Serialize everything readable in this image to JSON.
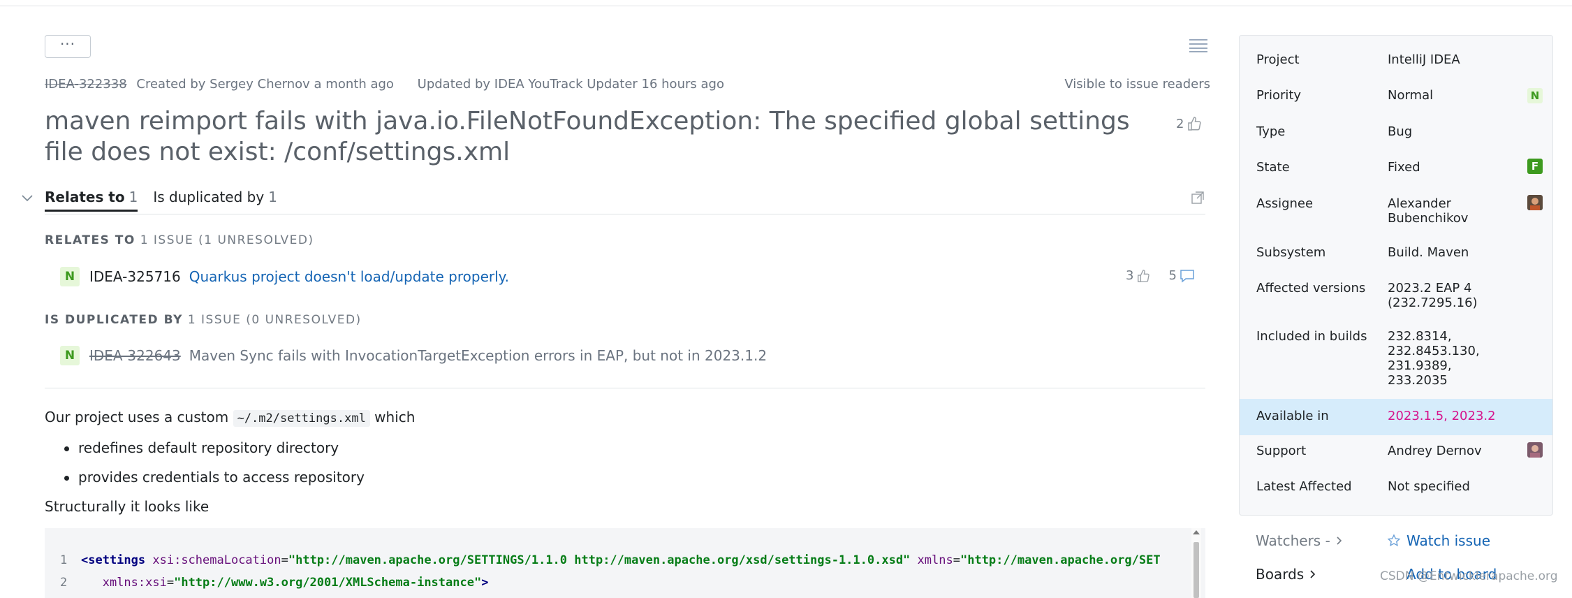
{
  "toolbar": {
    "more_label": "···"
  },
  "issue": {
    "id": "IDEA-322338",
    "created": "Created by Sergey Chernov a month ago",
    "updated": "Updated by IDEA YouTrack Updater 16 hours ago",
    "visibility": "Visible to issue readers",
    "title": "maven reimport fails with java.io.FileNotFoundException: The specified global settings file does not exist: /conf/settings.xml",
    "votes": "2"
  },
  "links": {
    "tabs": [
      {
        "label": "Relates to",
        "count": "1"
      },
      {
        "label": "Is duplicated by",
        "count": "1"
      }
    ],
    "relates": {
      "head_label": "RELATES TO",
      "head_summary": "1 ISSUE (1 UNRESOLVED)",
      "item": {
        "badge": "N",
        "id": "IDEA-325716",
        "title": "Quarkus project doesn't load/update properly.",
        "votes": "3",
        "comments": "5"
      }
    },
    "duplicated": {
      "head_label": "IS DUPLICATED BY",
      "head_summary": "1 ISSUE (0 UNRESOLVED)",
      "item": {
        "badge": "N",
        "id": "IDEA-322643",
        "title": "Maven Sync fails with InvocationTargetException errors in EAP, but not in 2023.1.2"
      }
    }
  },
  "description": {
    "intro_before": "Our project uses a custom",
    "intro_code": "~/.m2/settings.xml",
    "intro_after": "which",
    "bullets": [
      "redefines default repository directory",
      "provides credentials to access repository"
    ],
    "structurally": "Structurally it looks like",
    "code": {
      "line1_no": "1",
      "line1_tag": "<settings",
      "line1_attr1": "xsi:schemaLocation",
      "line1_eq1": "=",
      "line1_val1": "\"http://maven.apache.org/SETTINGS/1.1.0 http://maven.apache.org/xsd/settings-1.1.0.xsd\"",
      "line1_attr2": "xmlns",
      "line1_eq2": "=",
      "line1_val2": "\"http://maven.apache.org/SET",
      "line2_no": "2",
      "line2_attr": "xmlns:xsi",
      "line2_eq": "=",
      "line2_val": "\"http://www.w3.org/2001/XMLSchema-instance\"",
      "line2_end": ">"
    }
  },
  "sidebar": {
    "fields": [
      {
        "name": "Project",
        "value": "IntelliJ IDEA"
      },
      {
        "name": "Priority",
        "value": "Normal",
        "indicator": "N"
      },
      {
        "name": "Type",
        "value": "Bug"
      },
      {
        "name": "State",
        "value": "Fixed",
        "indicator": "F"
      },
      {
        "name": "Assignee",
        "value": "Alexander Bubenchikov"
      },
      {
        "name": "Subsystem",
        "value": "Build. Maven"
      },
      {
        "name": "Affected versions",
        "value": "2023.2 EAP 4 (232.7295.16)"
      },
      {
        "name": "Included in builds",
        "value": "232.8314, 232.8453.130, 231.9389, 233.2035"
      },
      {
        "name": "Available in",
        "value": "2023.1.5, 2023.2"
      },
      {
        "name": "Support",
        "value": "Andrey Dernov"
      },
      {
        "name": "Latest Affected",
        "value": "Not specified"
      }
    ],
    "watchers_label": "Watchers -",
    "watch_label": "Watch issue",
    "boards_label": "Boards",
    "add_board_label": "Add to board"
  },
  "watermark": "CSDN @Entwicklerapache.org",
  "colors": {
    "link": "#1464b4",
    "available_in": "#d6148c",
    "state_fixed": "#3d9a1f",
    "highlight_row": "#d6ecfb"
  }
}
